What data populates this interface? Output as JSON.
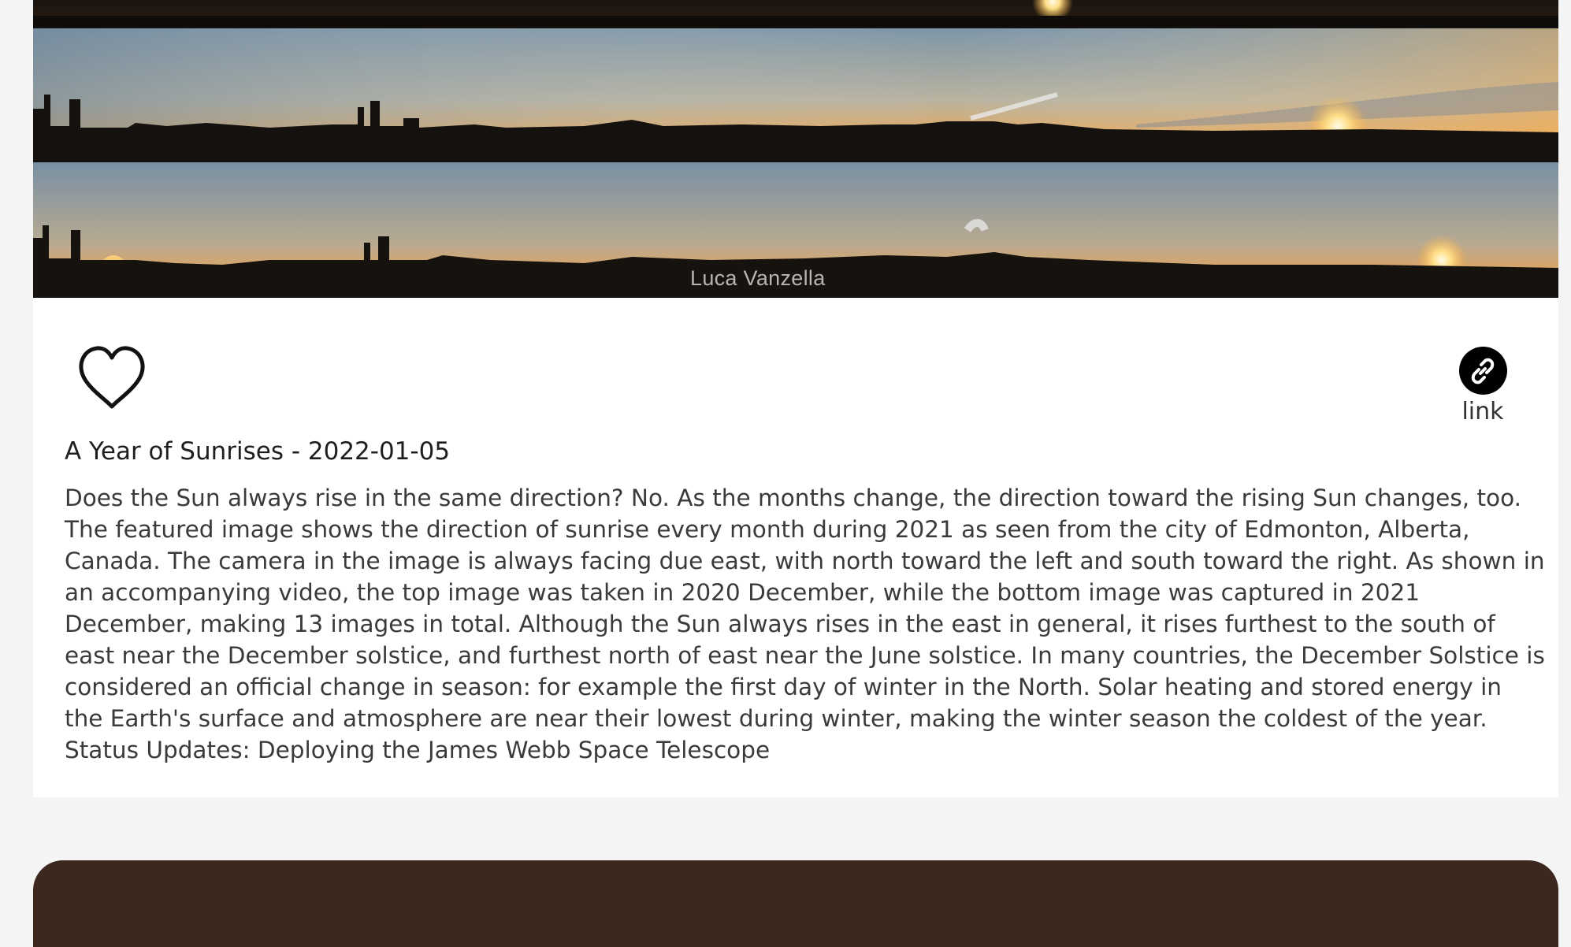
{
  "post": {
    "image_alt": "A Year of Sunrises",
    "photo_credit": "Luca Vanzella",
    "title": "A Year of Sunrises - 2022-01-05",
    "description": "Does the Sun always rise in the same direction? No. As the months change, the direction toward the rising Sun changes, too. The featured image shows the direction of sunrise every month during 2021 as seen from the city of Edmonton, Alberta, Canada. The camera in the image is always facing due east, with north toward the left and south toward the right. As shown in an accompanying video, the top image was taken in 2020 December, while the bottom image was captured in 2021 December, making 13 images in total. Although the Sun always rises in the east in general, it rises furthest to the south of east near the December solstice, and furthest north of east near the June solstice. In many countries, the December Solstice is considered an official change in season: for example the first day of winter in the North. Solar heating and stored energy in the Earth's surface and atmosphere are near their lowest during winter, making the winter season the coldest of the year. Status Updates: Deploying the James Webb Space Telescope"
  },
  "actions": {
    "like_icon": "heart-outline-icon",
    "link_icon": "link-icon",
    "link_label": "link"
  },
  "colors": {
    "page_background": "#f4f4f4",
    "card_background": "#ffffff",
    "next_card_background": "#3d2820",
    "link_circle": "#000000"
  }
}
